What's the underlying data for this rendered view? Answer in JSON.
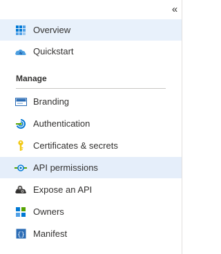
{
  "collapse_glyph": "«",
  "items_top": [
    {
      "label": "Overview",
      "icon": "overview-grid-icon"
    },
    {
      "label": "Quickstart",
      "icon": "quickstart-cloud-icon"
    }
  ],
  "section": {
    "title": "Manage"
  },
  "items_manage": [
    {
      "label": "Branding",
      "icon": "branding-icon"
    },
    {
      "label": "Authentication",
      "icon": "authentication-icon"
    },
    {
      "label": "Certificates & secrets",
      "icon": "key-icon"
    },
    {
      "label": "API permissions",
      "icon": "api-permissions-icon"
    },
    {
      "label": "Expose an API",
      "icon": "cloud-gear-icon"
    },
    {
      "label": "Owners",
      "icon": "owners-icon"
    },
    {
      "label": "Manifest",
      "icon": "manifest-icon"
    }
  ],
  "colors": {
    "selected_bg": "#e8f1fb",
    "accent_blue": "#0078d4"
  }
}
